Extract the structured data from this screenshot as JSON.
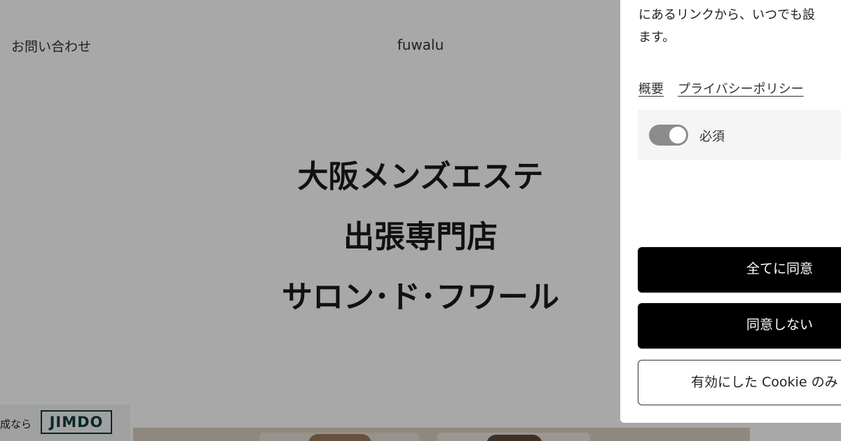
{
  "header": {
    "contact_label": "お問い合わせ",
    "logo": "fuwalu"
  },
  "hero": {
    "lines": [
      "大阪メンズエステ",
      "出張専門店",
      "サロン･ド･フワール"
    ]
  },
  "jimdo_badge": {
    "text": "成なら",
    "logo": "JIMDO"
  },
  "cookie_panel": {
    "description_lines": [
      "にあるリンクから、いつでも設",
      "ます。"
    ],
    "links": {
      "overview": "概要",
      "privacy_policy": "プライバシーポリシー"
    },
    "required_toggle": {
      "label": "必須",
      "enabled": true
    },
    "buttons": {
      "accept_all": "全てに同意",
      "decline": "同意しない",
      "accept_enabled": "有効にした Cookie のみ"
    }
  },
  "colors": {
    "overlay": "#000000",
    "button_bg": "#000000",
    "toggle_on": "#8c8c8c",
    "jimdo_brand": "#0d3d3d"
  }
}
